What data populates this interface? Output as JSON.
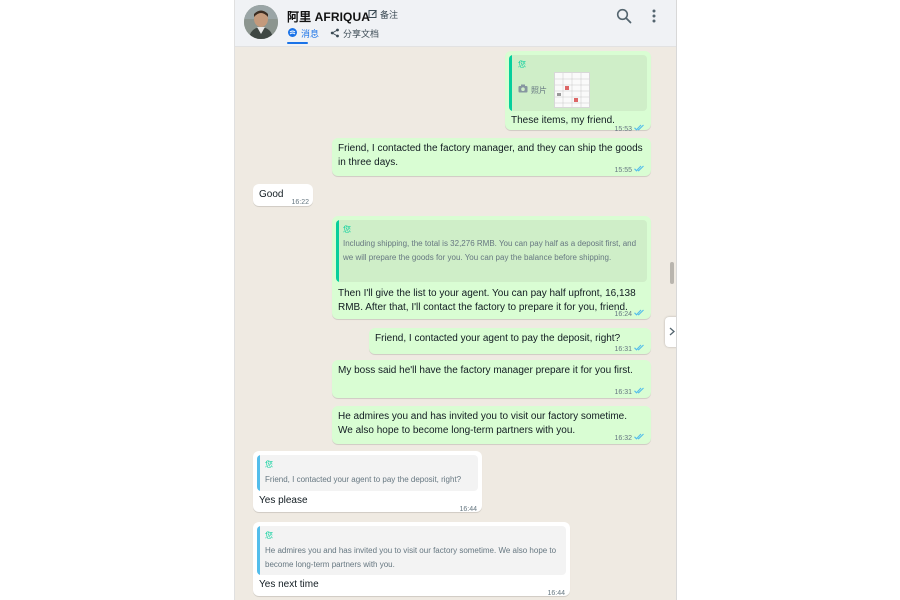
{
  "header": {
    "contact_name": "阿里 AFRIQUA",
    "remark_label": "备注",
    "tabs": [
      {
        "label": "消息",
        "active": true
      },
      {
        "label": "分享文档",
        "active": false
      }
    ]
  },
  "colors": {
    "outgoing_bubble": "#d9fdd3",
    "incoming_bubble": "#ffffff",
    "chat_background": "#efeae2",
    "read_ticks": "#53bdeb",
    "accent": "#1a73e8",
    "quote_bar_outgoing": "#06cf9c",
    "quote_bar_incoming": "#53bdeb"
  },
  "messages": [
    {
      "direction": "outgoing",
      "quote": {
        "author": "您",
        "attachment_label": "照片",
        "attachment_icon": "camera-icon"
      },
      "text": "These items, my friend.",
      "time": "15:53",
      "status": "read"
    },
    {
      "direction": "outgoing",
      "text": "Friend, I contacted the factory manager, and they can ship the goods in three days.",
      "time": "15:55",
      "status": "read"
    },
    {
      "direction": "incoming",
      "text": "Good",
      "time": "16:22"
    },
    {
      "direction": "outgoing",
      "quote": {
        "author": "您",
        "text": "Including shipping, the total is 32,276 RMB. You can pay half as a deposit first, and we will prepare the goods for you. You can pay the balance before shipping."
      },
      "text": "Then I'll give the list to your agent. You can pay half upfront, 16,138 RMB. After that, I'll contact the factory to prepare it for you, friend.",
      "time": "16:24",
      "status": "read"
    },
    {
      "direction": "outgoing",
      "text": "Friend, I contacted your agent to pay the deposit, right?",
      "time": "16:31",
      "status": "read"
    },
    {
      "direction": "outgoing",
      "text": "My boss said he'll have the factory manager prepare it for you first.",
      "time": "16:31",
      "status": "read"
    },
    {
      "direction": "outgoing",
      "text": "He admires you and has invited you to visit our factory sometime. We also hope to become long-term partners with you.",
      "time": "16:32",
      "status": "read"
    },
    {
      "direction": "incoming",
      "quote": {
        "author": "您",
        "text": "Friend, I contacted your agent to pay the deposit, right?"
      },
      "text": "Yes please",
      "time": "16:44"
    },
    {
      "direction": "incoming",
      "quote": {
        "author": "您",
        "text": "He admires you and has invited you to visit our factory sometime. We also hope to become long-term partners with you."
      },
      "text": "Yes next time",
      "time": "16:44"
    }
  ]
}
